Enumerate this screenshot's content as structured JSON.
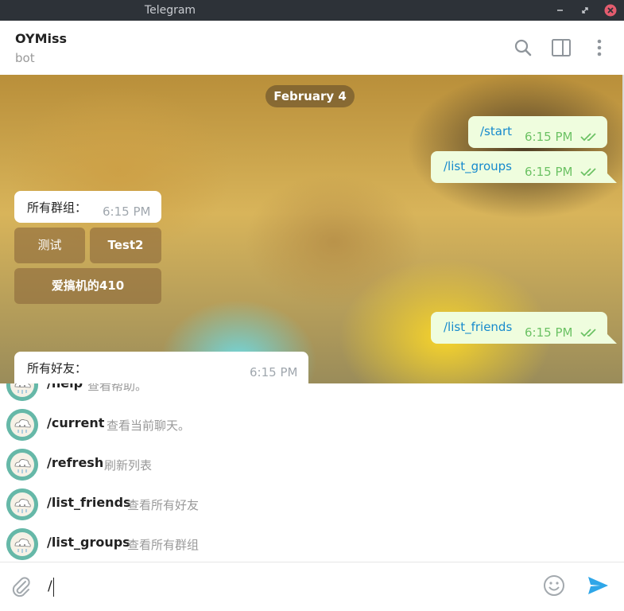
{
  "window": {
    "title": "Telegram"
  },
  "header": {
    "chat_name": "OYMiss",
    "status": "bot"
  },
  "chat": {
    "date": "February 4",
    "messages": [
      {
        "text": "/start",
        "time": "6:15 PM"
      },
      {
        "text": "/list_groups",
        "time": "6:15 PM"
      },
      {
        "text": "所有群组：",
        "time": "6:15 PM"
      },
      {
        "text": "/list_friends",
        "time": "6:15 PM"
      },
      {
        "text": "所有好友：",
        "time": "6:15 PM"
      }
    ],
    "group_buttons": [
      "测试",
      "Test2",
      "爱搞机的410"
    ]
  },
  "commands": [
    {
      "name": "/help",
      "desc": "查看帮助。"
    },
    {
      "name": "/current",
      "desc": "查看当前聊天。"
    },
    {
      "name": "/refresh",
      "desc": "刷新列表"
    },
    {
      "name": "/list_friends",
      "desc": "查看所有好友"
    },
    {
      "name": "/list_groups",
      "desc": "查看所有群组"
    }
  ],
  "composer": {
    "value": "/"
  },
  "colors": {
    "accent": "#168acd",
    "outgoing_bubble": "#effdde",
    "read_check": "#6cc264",
    "titlebar": "#2d3238"
  },
  "icons": [
    "minimize-icon",
    "restore-icon",
    "close-icon",
    "search-icon",
    "sidebar-toggle-icon",
    "more-vertical-icon",
    "bot-avatar-icon",
    "paperclip-icon",
    "emoji-icon",
    "send-icon"
  ]
}
